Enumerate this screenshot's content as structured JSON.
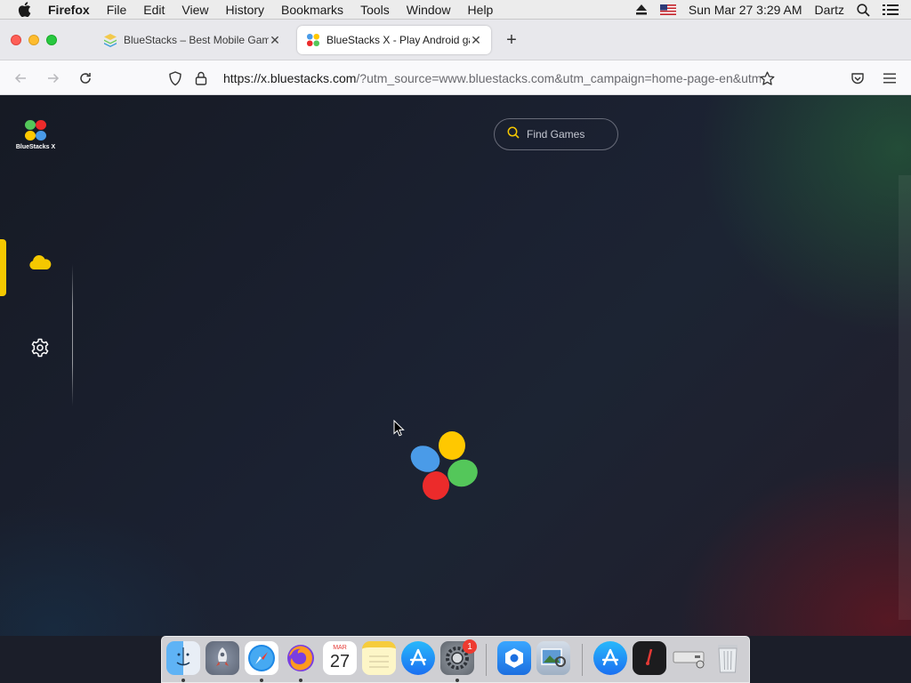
{
  "menubar": {
    "app_name": "Firefox",
    "items": [
      "File",
      "Edit",
      "View",
      "History",
      "Bookmarks",
      "Tools",
      "Window",
      "Help"
    ],
    "clock": "Sun Mar 27  3:29 AM",
    "user": "Dartz"
  },
  "browser": {
    "tabs": [
      {
        "title": "BlueStacks – Best Mobile Gaming Platform",
        "active": false
      },
      {
        "title": "BlueStacks X - Play Android games",
        "active": true
      }
    ],
    "url_host": "https://x.bluestacks.com",
    "url_rest": "/?utm_source=www.bluestacks.com&utm_campaign=home-page-en&utm_medium=cta"
  },
  "page": {
    "logo_text": "BlueStacks X",
    "search_placeholder": "Find Games",
    "accent_color": "#f5c800"
  },
  "dock": {
    "calendar_month": "MAR",
    "calendar_day": "27",
    "settings_badge": "1",
    "apps": [
      "finder-icon",
      "launchpad-icon",
      "safari-icon",
      "firefox-icon",
      "calendar-icon",
      "notes-icon",
      "app-store-icon",
      "system-preferences-icon",
      "bluestacks-icon",
      "preview-icon",
      "app-store-downloads-icon",
      "dictionary-icon",
      "disk-utility-icon",
      "trash-icon"
    ]
  }
}
